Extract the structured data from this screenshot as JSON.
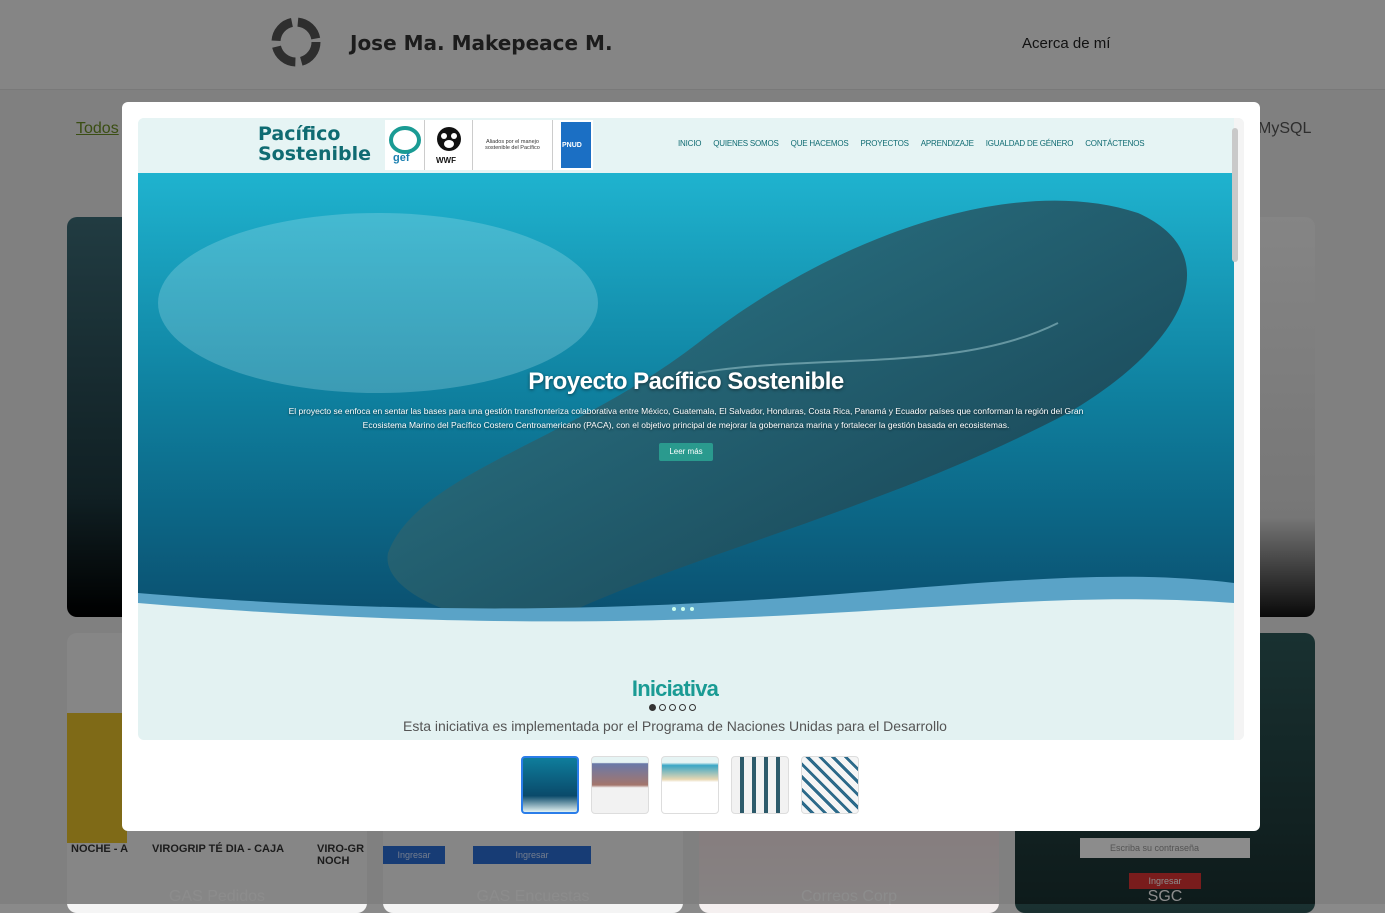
{
  "site": {
    "owner_name": "Jose Ma. Makepeace M.",
    "nav_about": "Acerca de mí",
    "filters": {
      "all": "Todos",
      "mysql": "MySQL"
    },
    "cards": [
      "GAS Pedidos",
      "GAS Encuestas",
      "Correos Corp",
      "SGC"
    ],
    "product_labels": [
      "NOCHE - A",
      "VIROGRIP TÉ DIA - CAJA",
      "VIRO-GR NOCH"
    ],
    "login_placeholder": "Escriba su contraseña",
    "login_button": "Ingresar"
  },
  "modal": {
    "preview": {
      "brand_line1": "Pacífico",
      "brand_line2": "Sostenible",
      "partner_gef": "gef",
      "partner_wwf": "WWF",
      "partner_text": "Aliados por el manejo sostenible del Pacífico",
      "partner_pnud": "PNUD",
      "nav": [
        "INICIO",
        "QUIENES SOMOS",
        "QUE HACEMOS",
        "PROYECTOS",
        "APRENDIZAJE",
        "IGUALDAD DE GÉNERO",
        "CONTÁCTENOS"
      ],
      "hero_title": "Proyecto Pacífico Sostenible",
      "hero_text": "El proyecto se enfoca en sentar las bases para una gestión transfronteriza colaborativa entre México, Guatemala, El Salvador, Honduras, Costa Rica, Panamá y Ecuador países que conforman la región del Gran Ecosistema Marino del Pacífico Costero Centroamericano (PACA), con el objetivo principal de mejorar la gobernanza marina y fortalecer la gestión basada en ecosistemas.",
      "hero_button": "Leer más",
      "section_title": "Iniciativa",
      "section_text": "Esta iniciativa es implementada por el Programa de Naciones Unidas para el Desarrollo"
    },
    "thumbnail_count": 5,
    "active_thumbnail": 1
  },
  "colors": {
    "accent": "#1a9b94",
    "brand": "#0f6b72",
    "thumb_active": "#2b7de9"
  }
}
